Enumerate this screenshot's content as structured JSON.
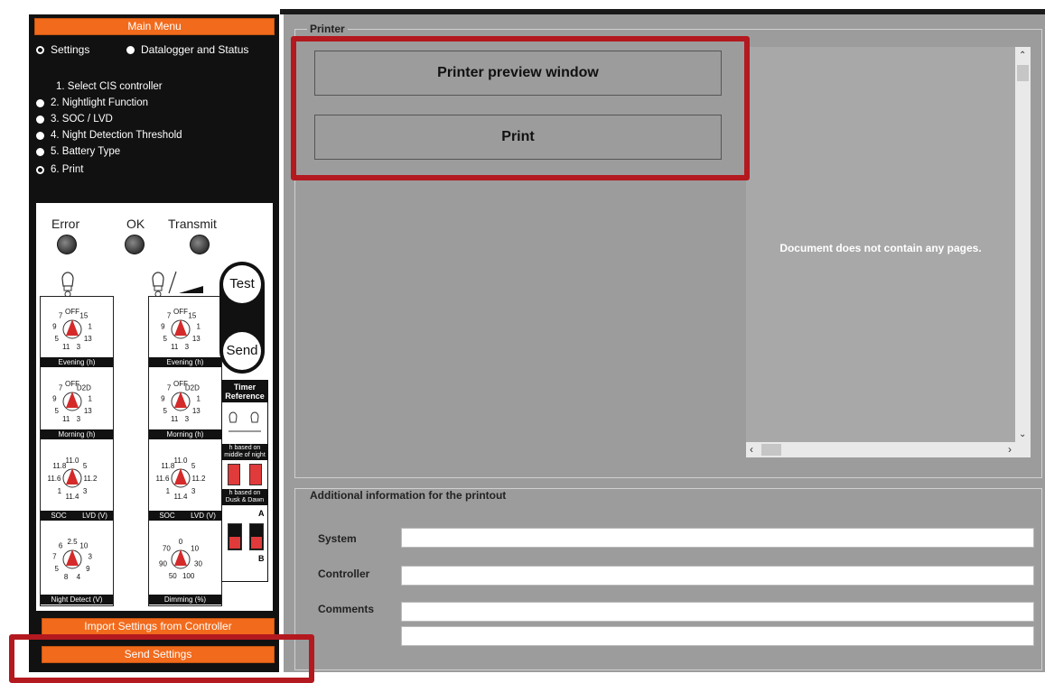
{
  "sidebar": {
    "main_menu": "Main Menu",
    "mode_settings": "Settings",
    "mode_datalogger": "Datalogger and Status",
    "steps": [
      "1. Select CIS controller",
      "2. Nightlight Function",
      "3. SOC / LVD",
      "4. Night Detection Threshold",
      "5. Battery Type",
      "6. Print"
    ],
    "import_button": "Import Settings from Controller",
    "send_button": "Send Settings"
  },
  "controller": {
    "leds": [
      "Error",
      "OK",
      "Transmit"
    ],
    "test_label": "Test",
    "send_label": "Send",
    "dial_labels": {
      "evening": "Evening (h)",
      "morning": "Morning (h)",
      "soc": "SOC",
      "lvd": "LVD (V)",
      "night_detect": "Night Detect (V)",
      "dimming": "Dimming (%)"
    },
    "dial_ticks": {
      "evening": [
        "OFF",
        "15",
        "1",
        "13",
        "3",
        "11",
        "5",
        "9",
        "7"
      ],
      "morning": [
        "OFF",
        "D2D",
        "1",
        "13",
        "3",
        "11",
        "5",
        "9",
        "7"
      ],
      "soc_lvd": [
        "11.0",
        "5",
        "11.2",
        "3",
        "11.4",
        "1",
        "11.6",
        "11.8"
      ],
      "night_detect": [
        "2.5",
        "10",
        "3",
        "9",
        "4",
        "8",
        "5",
        "7",
        "6"
      ],
      "dimming": [
        "0",
        "10",
        "30",
        "100",
        "50",
        "90",
        "70"
      ]
    },
    "timer": {
      "title": "Timer Reference",
      "middle": "h based on middle of night",
      "dusk": "h based on Dusk & Dawn",
      "a": "A",
      "b": "B"
    }
  },
  "printer": {
    "group_label": "Printer",
    "preview_button": "Printer preview window",
    "print_button": "Print",
    "empty_message": "Document does not contain any pages."
  },
  "additional": {
    "group_label": "Additional information for the printout",
    "system_label": "System",
    "controller_label": "Controller",
    "comments_label": "Comments",
    "system_value": "",
    "controller_value": "",
    "comments_value": "",
    "comments_value_2": ""
  },
  "colors": {
    "accent": "#f26a1b",
    "highlight": "#b3191f",
    "panel": "#9c9c9c"
  }
}
